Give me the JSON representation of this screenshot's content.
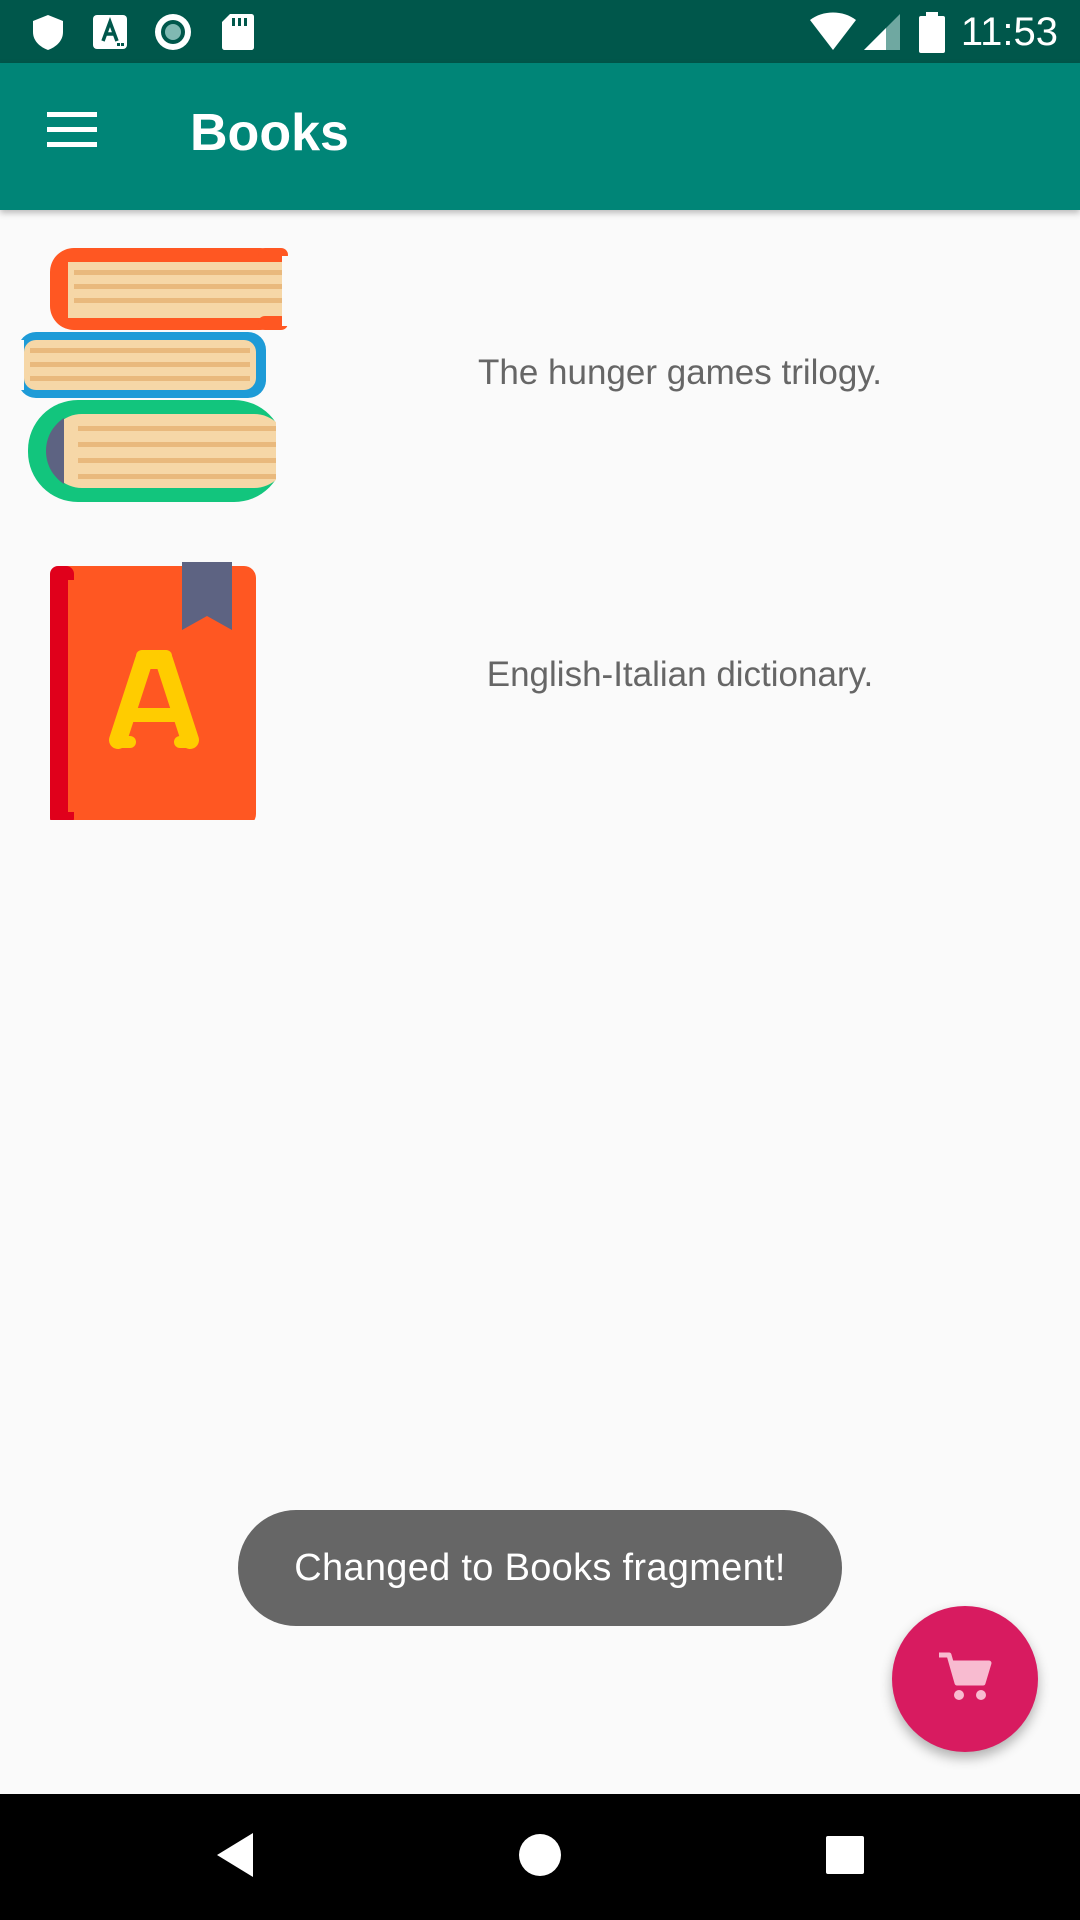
{
  "status_bar": {
    "time": "11:53",
    "icons": [
      "shield-icon",
      "app-a-icon",
      "record-icon",
      "sd-card-icon",
      "wifi-icon",
      "cell-signal-icon",
      "battery-icon"
    ]
  },
  "app_bar": {
    "title": "Books",
    "menu_icon": "menu-icon",
    "color": "#008577",
    "status_color": "#00574b"
  },
  "books": [
    {
      "title": "The hunger games trilogy.",
      "icon": "book-stack-icon"
    },
    {
      "title": "English-Italian dictionary.",
      "icon": "dictionary-icon"
    }
  ],
  "toast": {
    "message": "Changed to Books fragment!"
  },
  "fab": {
    "icon": "shopping-cart-icon",
    "color": "#d81b60"
  },
  "nav_bar": {
    "buttons": [
      "back-icon",
      "home-icon",
      "recents-icon"
    ]
  }
}
